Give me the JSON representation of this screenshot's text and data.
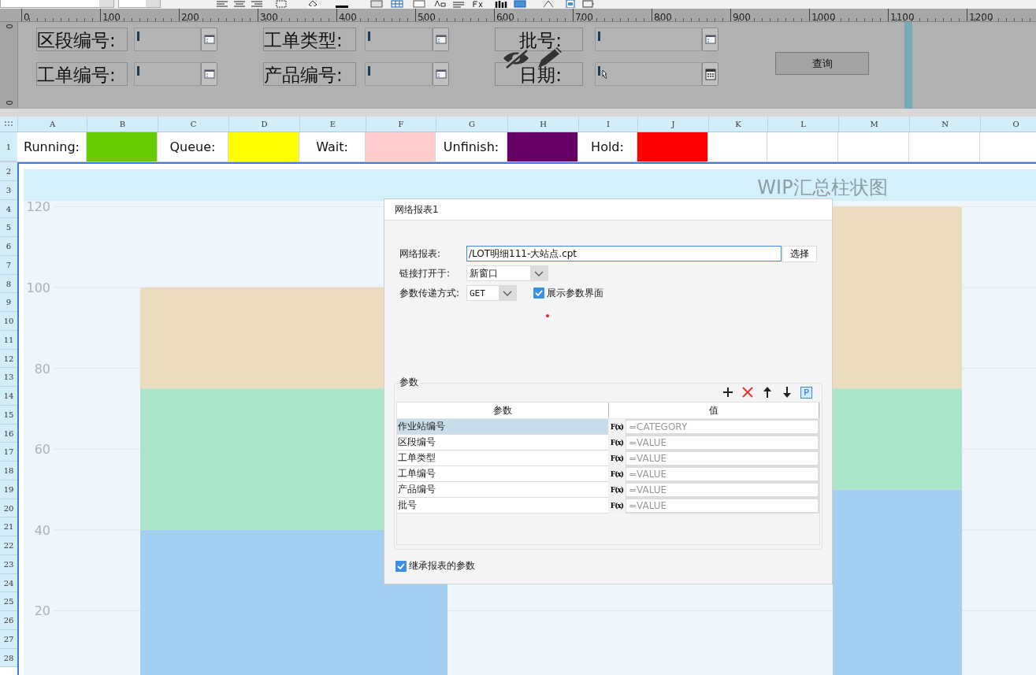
{
  "toolbar": {
    "font_field": {
      "kind": "select"
    },
    "size_field": {
      "kind": "select"
    }
  },
  "ruler": {
    "ticks": [
      "0",
      "100",
      "200",
      "300",
      "400",
      "500",
      "600",
      "700",
      "800",
      "900",
      "1000",
      "1100",
      "1200"
    ]
  },
  "parameter_pane": {
    "vertical_ruler_ticks": [
      "0",
      "0"
    ],
    "rows": [
      [
        {
          "label": "区段编号:",
          "kind": "text"
        },
        {
          "label": "工单类型:",
          "kind": "text"
        },
        {
          "label": "批号:",
          "kind": "text"
        }
      ],
      [
        {
          "label": "工单编号:",
          "kind": "text"
        },
        {
          "label": "产品编号:",
          "kind": "text"
        },
        {
          "label": "日期:",
          "kind": "date"
        }
      ]
    ],
    "query_button": "查询"
  },
  "sheet": {
    "columns": [
      "A",
      "B",
      "C",
      "D",
      "E",
      "F",
      "G",
      "H",
      "I",
      "J",
      "K",
      "L",
      "M",
      "N",
      "O"
    ],
    "row_numbers": [
      "1",
      "2",
      "3",
      "4",
      "5",
      "6",
      "7",
      "8",
      "9",
      "10",
      "11",
      "12",
      "13",
      "14",
      "15",
      "16",
      "17",
      "18",
      "19",
      "20",
      "21",
      "22",
      "23",
      "24",
      "25",
      "26",
      "27",
      "28"
    ],
    "legend": [
      {
        "label": "Running:",
        "color": "#66cc00"
      },
      {
        "label": "Queue:",
        "color": "#ffff00"
      },
      {
        "label": "Wait:",
        "color": "#ffcccc"
      },
      {
        "label": "Unfinish:",
        "color": "#660066"
      },
      {
        "label": "Hold:",
        "color": "#ff0000"
      }
    ]
  },
  "chart": {
    "title": "WIP汇总柱状图",
    "chart_data": {
      "type": "bar",
      "stacked": true,
      "grid": true,
      "ylim": [
        0,
        120
      ],
      "yticks": [
        20,
        40,
        60,
        80,
        100,
        120
      ],
      "series": [
        {
          "color": "#a3cff3",
          "values": [
            40,
            50
          ]
        },
        {
          "color": "#aae4c9",
          "values": [
            35,
            25
          ]
        },
        {
          "color": "#eadcbd",
          "values": [
            25,
            45
          ]
        }
      ]
    }
  },
  "dialog": {
    "title": "网络报表1",
    "report_label": "网络报表:",
    "report_path": "/LOT明细111-大站点.cpt",
    "choose_button": "选择",
    "open_in_label": "链接打开于:",
    "open_in": "新窗口",
    "method_label": "参数传递方式:",
    "method": "GET",
    "show_params": {
      "label": "展示参数界面",
      "checked": true
    },
    "params": {
      "legend": "参数",
      "tool_label": "P",
      "columns": [
        "参数",
        "值"
      ],
      "rows": [
        {
          "name": "作业站编号",
          "formula": "F(x)",
          "value": "=CATEGORY",
          "selected": true
        },
        {
          "name": "区段编号",
          "formula": "F(x)",
          "value": "=VALUE",
          "selected": false
        },
        {
          "name": "工单类型",
          "formula": "F(x)",
          "value": "=VALUE",
          "selected": false
        },
        {
          "name": "工单编号",
          "formula": "F(x)",
          "value": "=VALUE",
          "selected": false
        },
        {
          "name": "产品编号",
          "formula": "F(x)",
          "value": "=VALUE",
          "selected": false
        },
        {
          "name": "批号",
          "formula": "F(x)",
          "value": "=VALUE",
          "selected": false
        }
      ]
    },
    "inherit": {
      "label": "继承报表的参数",
      "checked": true
    }
  }
}
